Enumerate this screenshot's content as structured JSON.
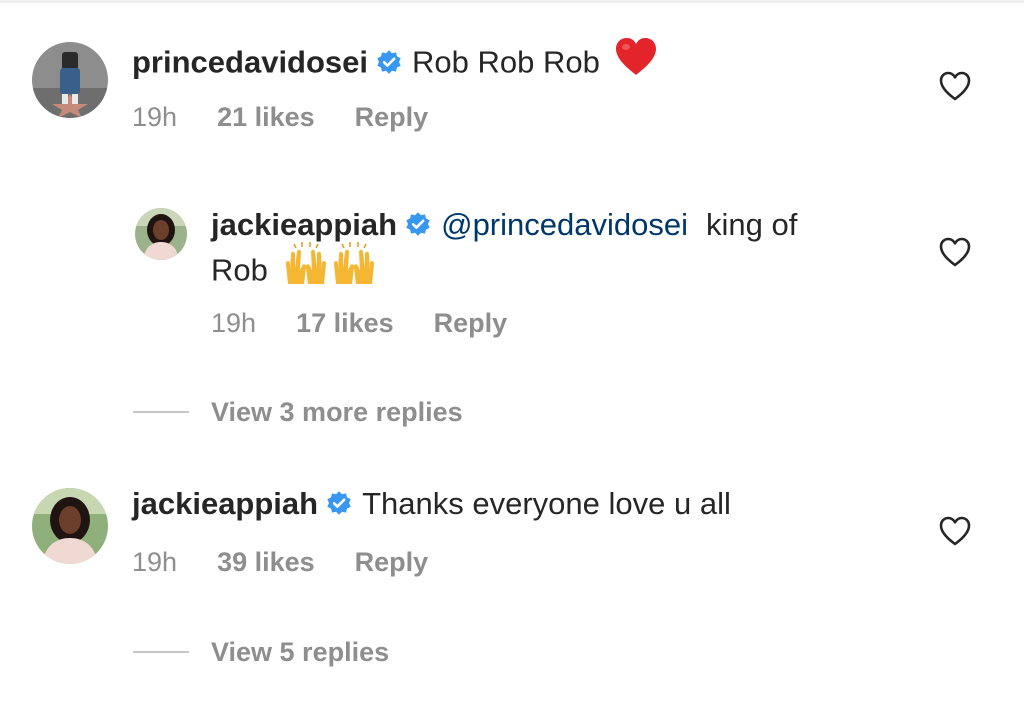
{
  "comments": [
    {
      "username": "princedavidosei",
      "verified": true,
      "text": "Rob Rob Rob",
      "emoji": "red-heart",
      "time": "19h",
      "likes": "21 likes",
      "reply_label": "Reply"
    },
    {
      "username": "jackieappiah",
      "verified": true,
      "mention": "@princedavidosei",
      "text_line1": "king of",
      "text_line2": "Rob",
      "emoji": "raising-hands x2",
      "time": "19h",
      "likes": "17 likes",
      "reply_label": "Reply"
    },
    {
      "username": "jackieappiah",
      "verified": true,
      "text": "Thanks everyone love u all",
      "time": "19h",
      "likes": "39 likes",
      "reply_label": "Reply"
    }
  ],
  "view_replies": [
    "View 3 more replies",
    "View 5 replies"
  ],
  "colors": {
    "text": "#262626",
    "meta": "#8e8e8e",
    "mention": "#00376b",
    "verified": "#3897f0",
    "heart": "#e0245e"
  },
  "icons": {
    "like": "heart-outline-icon",
    "verified": "verified-badge-icon"
  }
}
